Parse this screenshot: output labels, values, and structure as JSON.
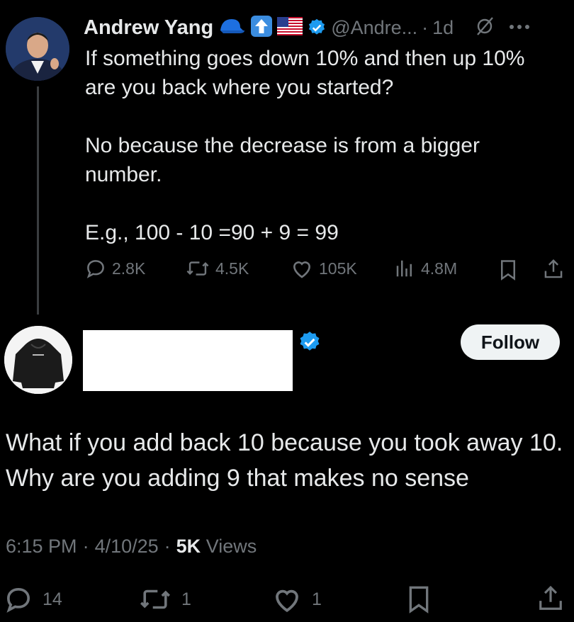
{
  "parent_tweet": {
    "author_name": "Andrew Yang",
    "handle": "@Andre...",
    "separator": "·",
    "time_ago": "1d",
    "text": "If something goes down 10% and then up 10% are you back where you started?\n\nNo because the decrease is from a bigger number.\n\nE.g., 100 - 10 =90 + 9 = 99",
    "replies": "2.8K",
    "reposts": "4.5K",
    "likes": "105K",
    "views": "4.8M",
    "emoji_icons": [
      "blue-cap-icon",
      "up-arrow-emoji-icon",
      "us-flag-icon"
    ],
    "verified_color": "#1d9bf0"
  },
  "reply_tweet": {
    "follow_label": "Follow",
    "text": "What if you add back 10 because you took away 10. Why are you adding 9 that makes no sense",
    "time": "6:15 PM",
    "date": "4/10/25",
    "dot": "·",
    "views_count": "5K",
    "views_label": "Views",
    "replies": "14",
    "reposts": "1",
    "likes": "1"
  },
  "colors": {
    "background": "#000000",
    "text": "#e7e9ea",
    "muted": "#71767b",
    "accent": "#1d9bf0"
  }
}
